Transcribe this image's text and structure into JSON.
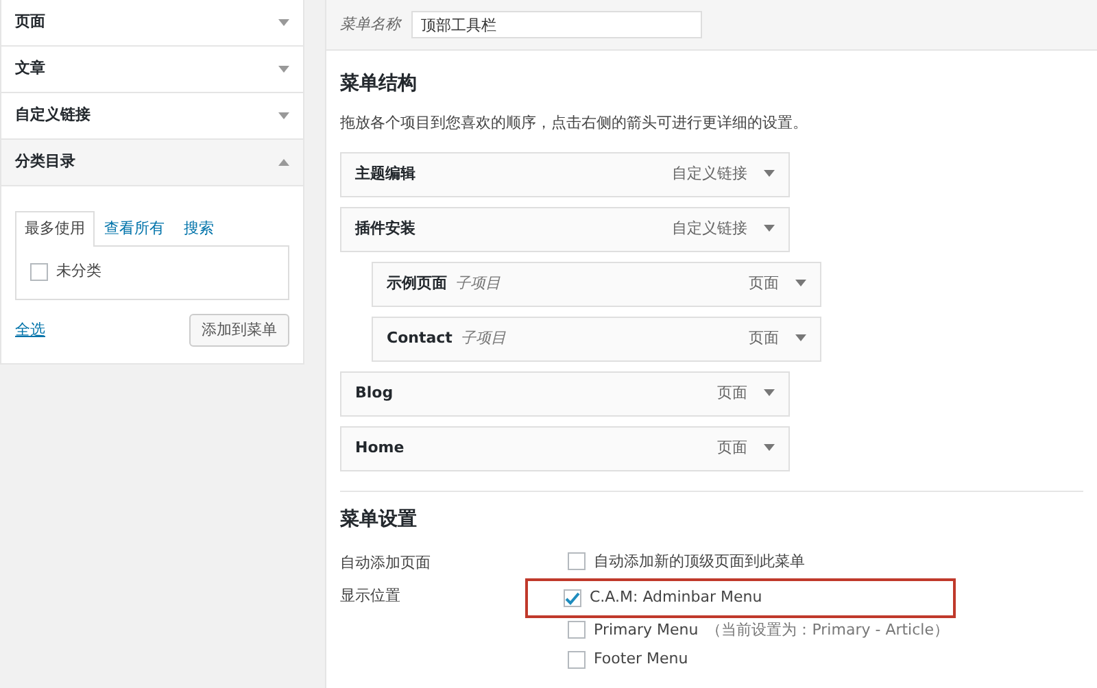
{
  "sidebar": {
    "sections": [
      {
        "title": "页面",
        "expanded": false
      },
      {
        "title": "文章",
        "expanded": false
      },
      {
        "title": "自定义链接",
        "expanded": false
      },
      {
        "title": "分类目录",
        "expanded": true,
        "tabs": [
          {
            "label": "最多使用",
            "selected": true
          },
          {
            "label": "查看所有",
            "selected": false
          },
          {
            "label": "搜索",
            "selected": false
          }
        ],
        "items": [
          {
            "label": "未分类",
            "checked": false
          }
        ],
        "select_all": "全选",
        "add_button": "添加到菜单"
      }
    ]
  },
  "menu_name": {
    "label": "菜单名称",
    "value": "顶部工具栏"
  },
  "structure": {
    "title": "菜单结构",
    "hint": "拖放各个项目到您喜欢的顺序，点击右侧的箭头可进行更详细的设置。",
    "items": [
      {
        "title": "主题编辑",
        "type": "自定义链接"
      },
      {
        "title": "插件安装",
        "type": "自定义链接",
        "children": [
          {
            "title": "示例页面",
            "note": "子项目",
            "type": "页面"
          },
          {
            "title": "Contact",
            "note": "子项目",
            "type": "页面"
          }
        ]
      },
      {
        "title": "Blog",
        "type": "页面"
      },
      {
        "title": "Home",
        "type": "页面"
      }
    ]
  },
  "settings": {
    "title": "菜单设置",
    "auto_add": {
      "label": "自动添加页面",
      "option": "自动添加新的顶级页面到此菜单",
      "checked": false
    },
    "locations": {
      "label": "显示位置",
      "options": [
        {
          "name": "C.A.M: Adminbar Menu",
          "checked": true,
          "highlighted": true
        },
        {
          "name": "Primary Menu",
          "note": "（当前设置为：Primary - Article）",
          "checked": false,
          "highlighted": false
        },
        {
          "name": "Footer Menu",
          "checked": false,
          "highlighted": false
        }
      ]
    }
  }
}
